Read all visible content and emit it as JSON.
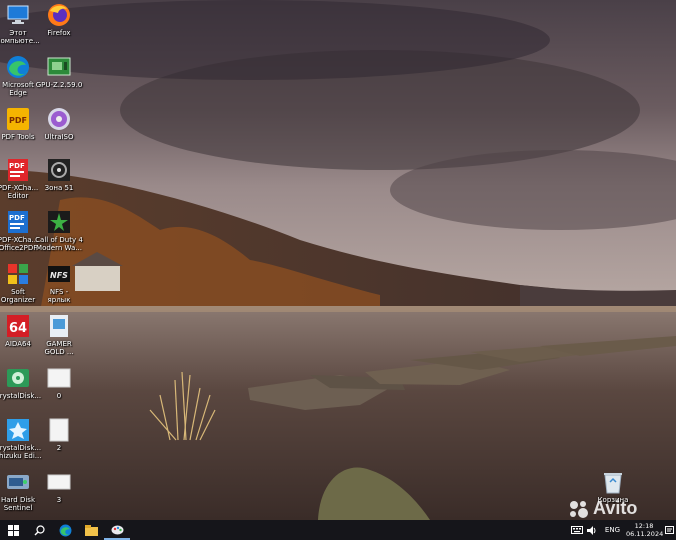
{
  "desktop_icons": [
    {
      "label": "Этот\nкомпьюте...",
      "icon": "this-pc-icon"
    },
    {
      "label": "Firefox",
      "icon": "firefox-icon"
    },
    {
      "label": "Microsoft\nEdge",
      "icon": "edge-icon"
    },
    {
      "label": "GPU-Z.2.59.0",
      "icon": "gpu-z-icon"
    },
    {
      "label": "PDF Tools",
      "icon": "pdf-tools-icon"
    },
    {
      "label": "UltraISO",
      "icon": "ultraiso-icon"
    },
    {
      "label": "PDF-XCha...\nEditor",
      "icon": "pdf-xchange-editor-icon"
    },
    {
      "label": "Зона 51",
      "icon": "zona51-icon"
    },
    {
      "label": "PDF-XCha...\nOffice2PDF",
      "icon": "pdf-xchange-office2pdf-icon"
    },
    {
      "label": "Call of Duty 4\nModern Wa...",
      "icon": "call-of-duty-icon"
    },
    {
      "label": "Soft\nOrganizer",
      "icon": "soft-organizer-icon"
    },
    {
      "label": "NFS -\nярлык",
      "icon": "nfs-shortcut-icon"
    },
    {
      "label": "AIDA64",
      "icon": "aida64-icon"
    },
    {
      "label": "GAMER\nGOLD ...",
      "icon": "gamer-gold-icon"
    },
    {
      "label": "CrystalDisk...",
      "icon": "crystaldisk-icon"
    },
    {
      "label": "0",
      "icon": "document-thumbnail-icon"
    },
    {
      "label": "CrystalDisk...\nShizuku Edi...",
      "icon": "crystaldisk-shizuku-icon"
    },
    {
      "label": "2",
      "icon": "document-thumbnail-icon"
    },
    {
      "label": "Hard Disk\nSentinel",
      "icon": "hard-disk-sentinel-icon"
    },
    {
      "label": "3",
      "icon": "document-thumbnail-icon"
    }
  ],
  "recycle_bin": {
    "label": "Корзина",
    "icon": "recycle-bin-icon"
  },
  "taskbar": {
    "apps": [
      "windows-start-icon",
      "search-icon",
      "edge-icon",
      "file-explorer-icon",
      "paint-app-icon"
    ],
    "lang": "ENG",
    "time": "12:18",
    "date": "06.11.2024"
  },
  "watermark": {
    "text": "Avito"
  },
  "colors": {
    "taskbar": "#15151a",
    "sky": "#6c5a5c",
    "water": "#4a3b36"
  }
}
